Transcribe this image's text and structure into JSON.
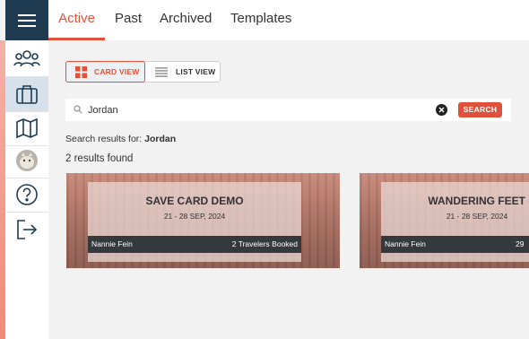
{
  "tabs": [
    {
      "label": "Active",
      "active": true
    },
    {
      "label": "Past",
      "active": false
    },
    {
      "label": "Archived",
      "active": false
    },
    {
      "label": "Templates",
      "active": false
    }
  ],
  "sidebar": {
    "items": [
      {
        "icon": "menu-icon"
      },
      {
        "icon": "travelers-icon"
      },
      {
        "icon": "briefcase-icon",
        "active": true
      },
      {
        "icon": "map-icon"
      },
      {
        "icon": "avatar"
      },
      {
        "icon": "help-icon"
      },
      {
        "icon": "logout-icon"
      }
    ]
  },
  "view_toggle": {
    "card_label": "CARD VIEW",
    "list_label": "LIST VIEW",
    "selected": "card"
  },
  "search": {
    "value": "Jordan",
    "button_label": "SEARCH"
  },
  "results": {
    "prefix": "Search results for:",
    "query": "Jordan",
    "count_text": "2 results found"
  },
  "cards": [
    {
      "title": "SAVE CARD DEMO",
      "dates": "21 - 28 SEP, 2024",
      "owner": "Nannie Fein",
      "travelers": "2 Travelers Booked"
    },
    {
      "title": "WANDERING FEET - JO",
      "dates": "21 - 28 SEP, 2024",
      "owner": "Nannie Fein",
      "travelers": "29"
    }
  ],
  "colors": {
    "accent": "#e0513c",
    "navy": "#1e3b52",
    "active_side_bg": "#d6e1ea"
  }
}
